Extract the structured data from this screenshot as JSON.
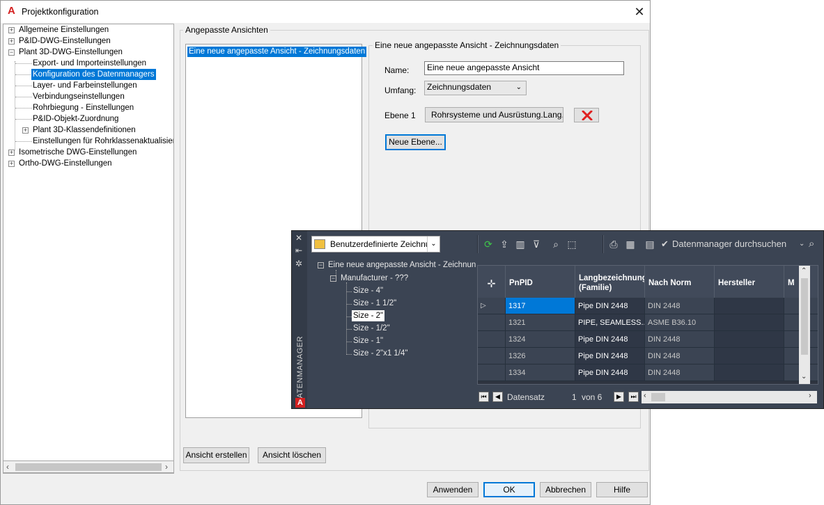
{
  "window": {
    "title": "Projektkonfiguration",
    "close_glyph": "✕",
    "app_logo_letter": "A"
  },
  "tree": {
    "items": [
      {
        "label": "Allgemeine Einstellungen",
        "expander": "+"
      },
      {
        "label": "P&ID-DWG-Einstellungen",
        "expander": "+"
      },
      {
        "label": "Plant 3D-DWG-Einstellungen",
        "expander": "−"
      },
      {
        "label": "Export- und Importeinstellungen"
      },
      {
        "label": "Konfiguration des Datenmanagers",
        "selected": true
      },
      {
        "label": "Layer- und Farbeinstellungen"
      },
      {
        "label": "Verbindungseinstellungen"
      },
      {
        "label": "Rohrbiegung - Einstellungen"
      },
      {
        "label": "P&ID-Objekt-Zuordnung"
      },
      {
        "label": "Plant 3D-Klassendefinitionen",
        "expander": "+"
      },
      {
        "label": "Einstellungen für Rohrklassenaktualisierung"
      },
      {
        "label": "Isometrische DWG-Einstellungen",
        "expander": "+"
      },
      {
        "label": "Ortho-DWG-Einstellungen",
        "expander": "+"
      }
    ],
    "hscroll_left": "‹",
    "hscroll_right": "›"
  },
  "custom_views": {
    "group_label": "Angepasste Ansichten",
    "list_items": [
      "Eine neue angepasste Ansicht - Zeichnungsdaten"
    ],
    "create_button": "Ansicht erstellen",
    "delete_button": "Ansicht löschen"
  },
  "details": {
    "group_label": "Eine neue angepasste Ansicht - Zeichnungsdaten",
    "name_label": "Name:",
    "name_value": "Eine neue angepasste Ansicht",
    "scope_label": "Umfang:",
    "scope_value": "Zeichnungsdaten",
    "level_label": "Ebene 1",
    "level_value": "Rohrsysteme  und Ausrüstung.Lang...",
    "new_level_button": "Neue Ebene..."
  },
  "footer": {
    "apply": "Anwenden",
    "ok": "OK",
    "cancel": "Abbrechen",
    "help": "Hilfe"
  },
  "datenmanager": {
    "side_title": "DATENMANAGER",
    "combo_value": "Benutzerdefinierte Zeichnu",
    "search_placeholder": "Datenmanager durchsuchen",
    "tree": {
      "root": "Eine neue angepasste Ansicht - Zeichnun",
      "child": "Manufacturer - ???",
      "leaves": [
        "Size - 4\"",
        "Size - 1 1/2\"",
        "Size - 2\"",
        "Size - 1/2\"",
        "Size - 1\"",
        "Size - 2\"x1 1/4\""
      ],
      "selected_leaf": "Size - 2\""
    },
    "grid": {
      "columns": [
        "PnPID",
        "Langbezeichnung (Familie)",
        "Nach Norm",
        "Hersteller",
        "M"
      ],
      "rows": [
        {
          "pnpid": "1317",
          "lang": "Pipe DIN 2448",
          "norm": "DIN 2448",
          "current": true
        },
        {
          "pnpid": "1321",
          "lang": "PIPE, SEAMLESS...",
          "norm": "ASME B36.10"
        },
        {
          "pnpid": "1324",
          "lang": "Pipe DIN 2448",
          "norm": "DIN 2448"
        },
        {
          "pnpid": "1326",
          "lang": "Pipe DIN 2448",
          "norm": "DIN 2448"
        },
        {
          "pnpid": "1334",
          "lang": "Pipe DIN 2448",
          "norm": "DIN 2448"
        }
      ]
    },
    "nav": {
      "label": "Datensatz",
      "current": "1",
      "of_label": "von 6"
    }
  },
  "colors": {
    "selection": "#0078d7",
    "palette_bg": "#3b4453",
    "delete_red": "#e02020"
  }
}
